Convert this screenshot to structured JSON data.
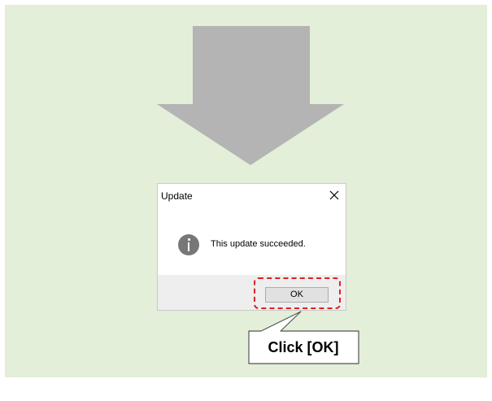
{
  "dialog": {
    "title": "Update",
    "close_icon": "close-icon",
    "info_icon": "info-icon",
    "message": "This update succeeded.",
    "ok_label": "OK"
  },
  "callout": {
    "text": "Click [OK]"
  },
  "colors": {
    "background": "#e3efd9",
    "arrow": "#b4b4b4",
    "highlight": "#e02020"
  }
}
